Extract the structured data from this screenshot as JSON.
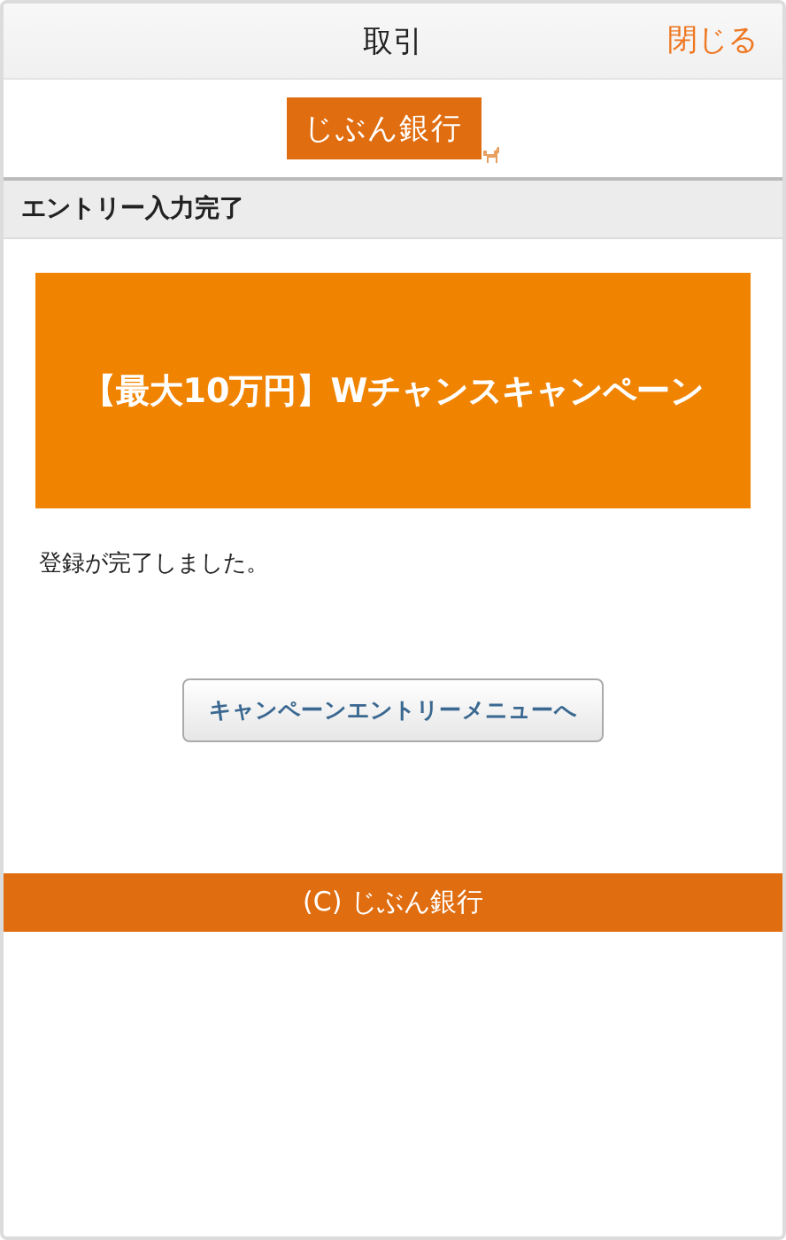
{
  "header": {
    "title": "取引",
    "close_label": "閉じる"
  },
  "logo": {
    "text": "じぶん銀行"
  },
  "section_title": "エントリー入力完了",
  "banner": {
    "text": "【最大10万円】Wチャンスキャンペーン"
  },
  "message": "登録が完了しました。",
  "button": {
    "label": "キャンペーンエントリーメニューへ"
  },
  "footer": "(C) じぶん銀行"
}
